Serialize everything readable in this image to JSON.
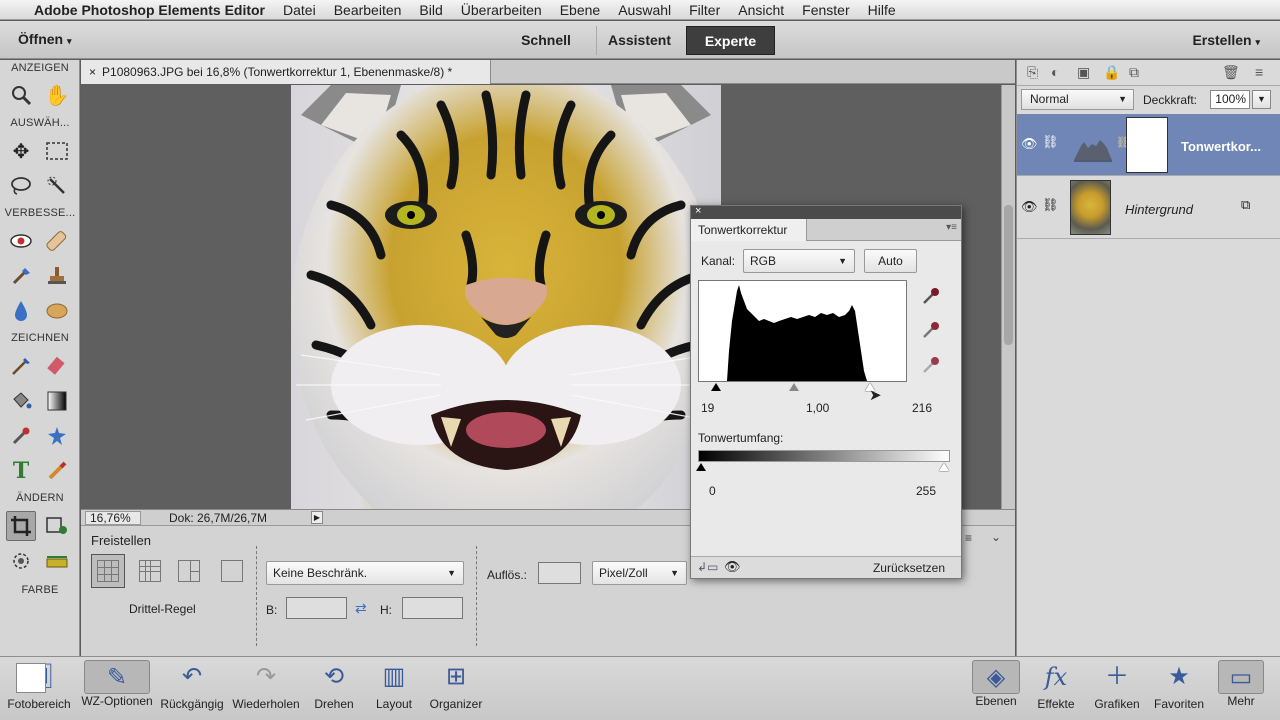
{
  "menubar": {
    "app_name": "Adobe Photoshop Elements Editor",
    "items": [
      "Datei",
      "Bearbeiten",
      "Bild",
      "Überarbeiten",
      "Ebene",
      "Auswahl",
      "Filter",
      "Ansicht",
      "Fenster",
      "Hilfe"
    ]
  },
  "appbar": {
    "open_label": "Öffnen",
    "modes": [
      "Schnell",
      "Assistent",
      "Experte"
    ],
    "active_mode": "Experte",
    "create_label": "Erstellen"
  },
  "toolbox": {
    "sections": [
      "ANZEIGEN",
      "AUSWÄH...",
      "VERBESSE...",
      "ZEICHNEN",
      "ÄNDERN",
      "FARBE"
    ]
  },
  "document": {
    "tab_title": "P1080963.JPG bei 16,8% (Tonwertkorrektur 1, Ebenenmaske/8) *",
    "zoom": "16,76%",
    "doc_size": "Dok: 26,7M/26,7M"
  },
  "tool_options": {
    "title": "Freistellen",
    "overlay_label": "Drittel-Regel",
    "ratio_value": "Keine Beschränk.",
    "width_label": "B:",
    "height_label": "H:",
    "resolution_label": "Auflös.:",
    "resolution_unit": "Pixel/Zoll"
  },
  "layers_panel": {
    "blend_mode": "Normal",
    "opacity_label": "Deckkraft:",
    "opacity_value": "100%",
    "layers": [
      {
        "name": "Tonwertkor...",
        "selected": true
      },
      {
        "name": "Hintergrund",
        "selected": false
      }
    ]
  },
  "levels_panel": {
    "tab_label": "Tonwertkorrektur",
    "channel_label": "Kanal:",
    "channel_value": "RGB",
    "auto_label": "Auto",
    "input_black": "19",
    "input_gamma": "1,00",
    "input_white": "216",
    "output_label": "Tonwertumfang:",
    "output_black": "0",
    "output_white": "255",
    "reset_label": "Zurücksetzen"
  },
  "taskbar": {
    "left": [
      "Fotobereich",
      "WZ-Optionen",
      "Rückgängig",
      "Wiederholen",
      "Drehen",
      "Layout",
      "Organizer"
    ],
    "right": [
      "Ebenen",
      "Effekte",
      "Grafiken",
      "Favoriten",
      "Mehr"
    ]
  },
  "colors": {
    "accent_selected_layer": "#6f86b6",
    "expert_tab": "#3e3e3e"
  }
}
